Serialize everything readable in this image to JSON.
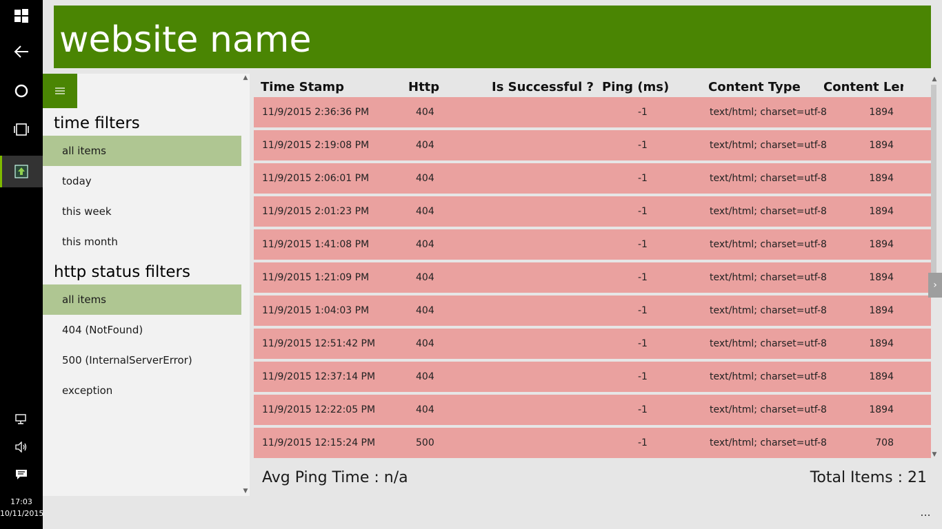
{
  "taskbar": {
    "icons": [
      "windows-start-icon",
      "back-arrow-icon",
      "cortana-circle-icon",
      "task-view-icon",
      "app-icon"
    ],
    "tray_icons": [
      "network-icon",
      "volume-icon",
      "action-center-icon"
    ],
    "time": "17:03",
    "date": "10/11/2015"
  },
  "header": {
    "title": "website name",
    "color": "#4a8503"
  },
  "sidebar": {
    "menu_icon": "hamburger-icon",
    "time_filters": {
      "heading": "time filters",
      "items": [
        "all items",
        "today",
        "this week",
        "this month"
      ],
      "selected": "all items"
    },
    "status_filters": {
      "heading": "http status filters",
      "items": [
        "all items",
        "404 (NotFound)",
        "500 (InternalServerError)",
        "exception"
      ],
      "selected": "all items"
    }
  },
  "grid": {
    "columns": [
      "Time Stamp",
      "Http",
      "Is Successful ?",
      "Ping (ms)",
      "Content Type",
      "Content Leng"
    ],
    "row_color": "#eaa19f",
    "rows": [
      {
        "ts": "11/9/2015 2:36:36 PM",
        "http": "404",
        "ping": "-1",
        "ct": "text/html; charset=utf-8",
        "cl": "1894"
      },
      {
        "ts": "11/9/2015 2:19:08 PM",
        "http": "404",
        "ping": "-1",
        "ct": "text/html; charset=utf-8",
        "cl": "1894"
      },
      {
        "ts": "11/9/2015 2:06:01 PM",
        "http": "404",
        "ping": "-1",
        "ct": "text/html; charset=utf-8",
        "cl": "1894"
      },
      {
        "ts": "11/9/2015 2:01:23 PM",
        "http": "404",
        "ping": "-1",
        "ct": "text/html; charset=utf-8",
        "cl": "1894"
      },
      {
        "ts": "11/9/2015 1:41:08 PM",
        "http": "404",
        "ping": "-1",
        "ct": "text/html; charset=utf-8",
        "cl": "1894"
      },
      {
        "ts": "11/9/2015 1:21:09 PM",
        "http": "404",
        "ping": "-1",
        "ct": "text/html; charset=utf-8",
        "cl": "1894"
      },
      {
        "ts": "11/9/2015 1:04:03 PM",
        "http": "404",
        "ping": "-1",
        "ct": "text/html; charset=utf-8",
        "cl": "1894"
      },
      {
        "ts": "11/9/2015 12:51:42 PM",
        "http": "404",
        "ping": "-1",
        "ct": "text/html; charset=utf-8",
        "cl": "1894"
      },
      {
        "ts": "11/9/2015 12:37:14 PM",
        "http": "404",
        "ping": "-1",
        "ct": "text/html; charset=utf-8",
        "cl": "1894"
      },
      {
        "ts": "11/9/2015 12:22:05 PM",
        "http": "404",
        "ping": "-1",
        "ct": "text/html; charset=utf-8",
        "cl": "1894"
      },
      {
        "ts": "11/9/2015 12:15:24 PM",
        "http": "500",
        "ping": "-1",
        "ct": "text/html; charset=utf-8",
        "cl": "708"
      }
    ]
  },
  "footer": {
    "avg_ping": "Avg Ping Time :  n/a",
    "total_items": "Total Items :  21"
  },
  "appbar": {
    "more_label": "..."
  }
}
